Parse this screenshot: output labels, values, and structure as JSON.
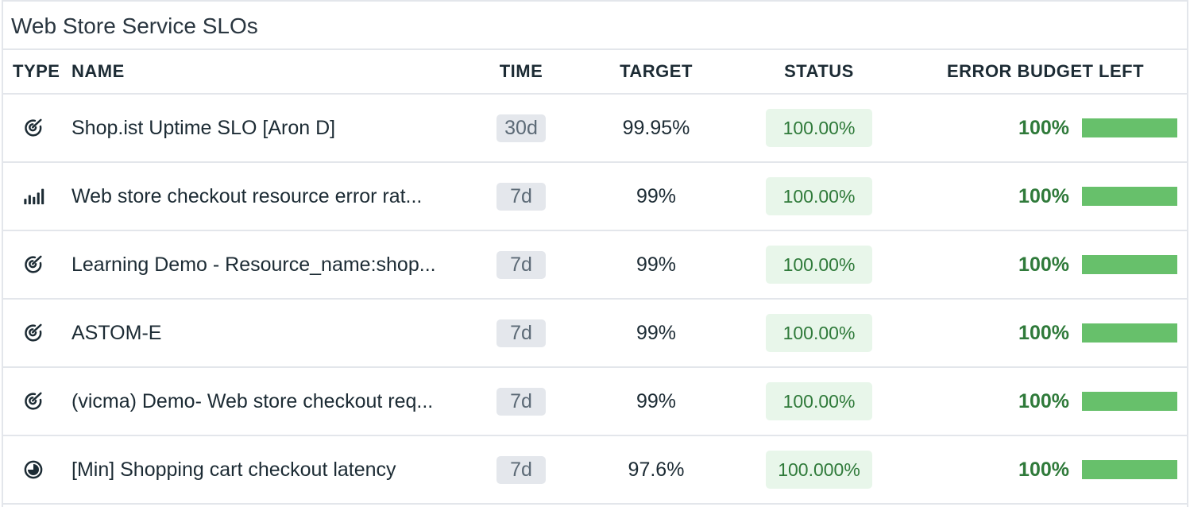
{
  "widget": {
    "title": "Web Store Service SLOs"
  },
  "columns": {
    "type": "TYPE",
    "name": "NAME",
    "time": "TIME",
    "target": "TARGET",
    "status": "STATUS",
    "budget": "ERROR BUDGET LEFT"
  },
  "colors": {
    "status_green": "#2f7a3a",
    "status_bg": "#e8f6ea",
    "bar_green": "#67c06b"
  },
  "rows": [
    {
      "type_icon": "monitor-target-icon",
      "name": "Shop.ist Uptime SLO [Aron D]",
      "time": "30d",
      "target": "99.95%",
      "status": "100.00%",
      "budget": "100%",
      "budget_fraction": 1.0
    },
    {
      "type_icon": "metric-bars-icon",
      "name": "Web store checkout resource error rat...",
      "time": "7d",
      "target": "99%",
      "status": "100.00%",
      "budget": "100%",
      "budget_fraction": 1.0
    },
    {
      "type_icon": "monitor-target-icon",
      "name": "Learning Demo - Resource_name:shop...",
      "time": "7d",
      "target": "99%",
      "status": "100.00%",
      "budget": "100%",
      "budget_fraction": 1.0
    },
    {
      "type_icon": "monitor-target-icon",
      "name": "ASTOM-E",
      "time": "7d",
      "target": "99%",
      "status": "100.00%",
      "budget": "100%",
      "budget_fraction": 1.0
    },
    {
      "type_icon": "monitor-target-icon",
      "name": "(vicma) Demo- Web store checkout req...",
      "time": "7d",
      "target": "99%",
      "status": "100.00%",
      "budget": "100%",
      "budget_fraction": 1.0
    },
    {
      "type_icon": "time-slice-icon",
      "name": "[Min] Shopping cart checkout latency",
      "time": "7d",
      "target": "97.6%",
      "status": "100.000%",
      "budget": "100%",
      "budget_fraction": 1.0
    }
  ]
}
